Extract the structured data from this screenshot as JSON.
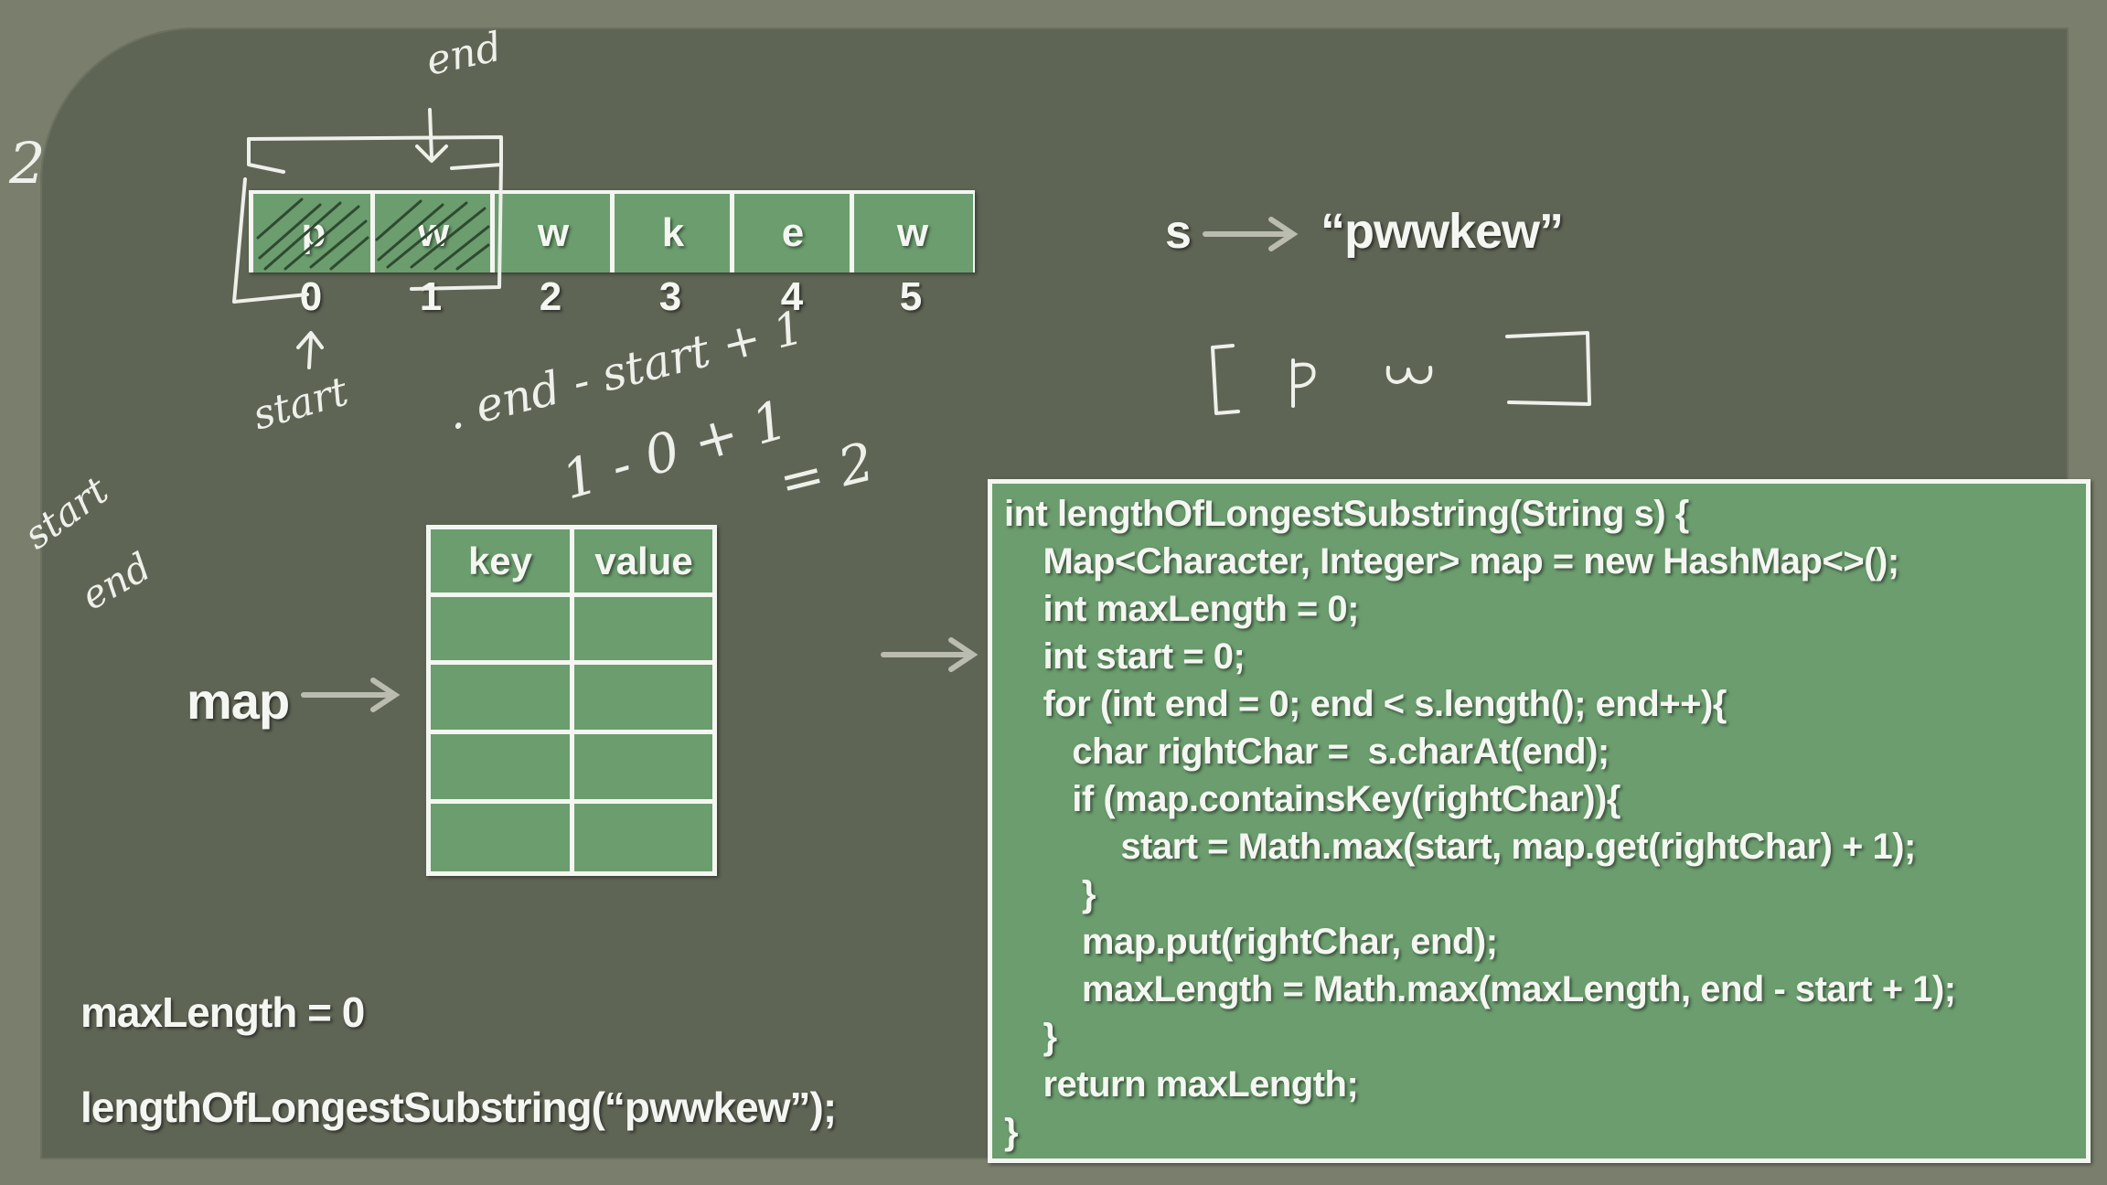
{
  "string_var": "s",
  "string_value": "“pwwkew”",
  "array": {
    "chars": [
      "p",
      "w",
      "w",
      "k",
      "e",
      "w"
    ],
    "indices": [
      "0",
      "1",
      "2",
      "3",
      "4",
      "5"
    ]
  },
  "map": {
    "label": "map",
    "headers": [
      "key",
      "value"
    ],
    "rows": [
      [
        "",
        ""
      ],
      [
        "",
        ""
      ],
      [
        "",
        ""
      ],
      [
        "",
        ""
      ]
    ]
  },
  "max_length_text": "maxLength = 0",
  "call_text": "lengthOfLongestSubstring(“pwwkew”);",
  "code": [
    "int lengthOfLongestSubstring(String s) {",
    "    Map<Character, Integer> map = new HashMap<>();",
    "    int maxLength = 0;",
    "    int start = 0;",
    "    for (int end = 0; end < s.length(); end++){",
    "       char rightChar =  s.charAt(end);",
    "       if (map.containsKey(rightChar)){",
    "            start = Math.max(start, map.get(rightChar) + 1);",
    "        }",
    "        map.put(rightChar, end);",
    "        maxLength = Math.max(maxLength, end - start + 1);",
    "    }",
    "    return maxLength;",
    "}"
  ],
  "handwritten": {
    "end_top": "end",
    "number_two": "2",
    "start_label": "start",
    "formula": ". end - start + 1",
    "calc": "1 - 0 + 1",
    "result": "= 2",
    "side_start": "start",
    "side_end": "end",
    "window": "[ p   w     ]"
  },
  "colors": {
    "board": "#5f6555",
    "cell_green": "#6b9d6e",
    "chalk": "#f4f6f1",
    "arrow": "#b9bcae"
  }
}
